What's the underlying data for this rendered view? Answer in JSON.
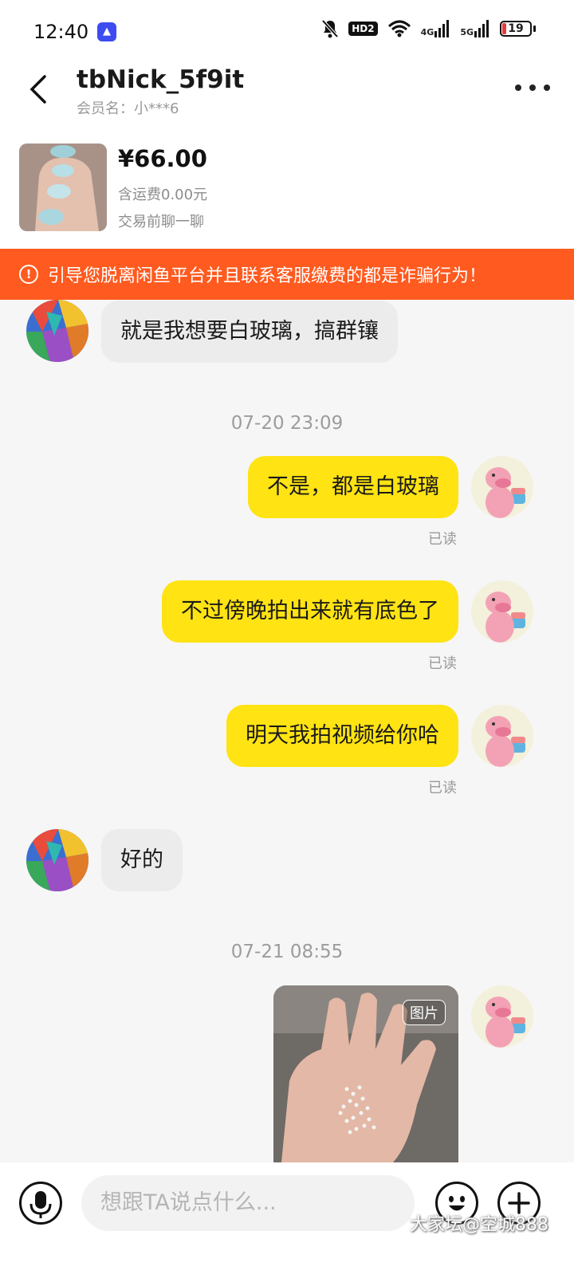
{
  "status_bar": {
    "time": "12:40",
    "hd_label": "HD2",
    "net_4g": "4G",
    "net_5g": "5G",
    "battery": "19"
  },
  "header": {
    "title": "tbNick_5f9it",
    "subtitle": "会员名：小***6"
  },
  "product": {
    "price": "¥66.00",
    "shipping": "含运费0.00元",
    "chat_before": "交易前聊一聊"
  },
  "warning": {
    "text": "引导您脱离闲鱼平台并且联系客服缴费的都是诈骗行为！"
  },
  "messages": [
    {
      "side": "left",
      "text": "就是我想要白玻璃，搞群镶"
    },
    {
      "timestamp": "07-20 23:09"
    },
    {
      "side": "right",
      "text": "不是，都是白玻璃",
      "status": "已读"
    },
    {
      "side": "right",
      "text": "不过傍晚拍出来就有底色了",
      "status": "已读"
    },
    {
      "side": "right",
      "text": "明天我拍视频给你哈",
      "status": "已读"
    },
    {
      "side": "left",
      "text": "好的"
    },
    {
      "timestamp": "07-21 08:55"
    },
    {
      "side": "right",
      "type": "image",
      "tag": "图片"
    }
  ],
  "input": {
    "placeholder": "想跟TA说点什么..."
  },
  "watermark": "大家坛@空城888",
  "colors": {
    "warning": "#ff5a1f",
    "my_bubble": "#ffe313",
    "their_bubble": "#ececec"
  }
}
